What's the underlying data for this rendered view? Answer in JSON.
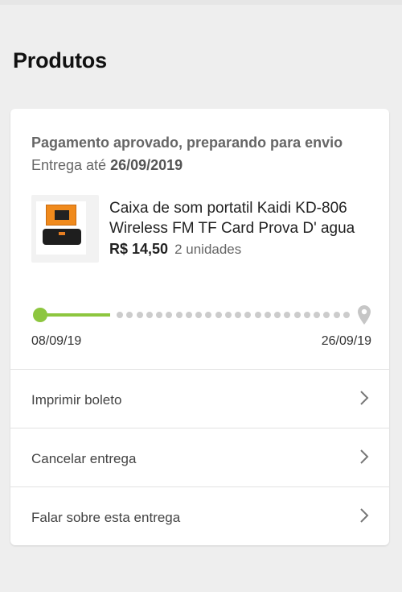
{
  "page": {
    "title": "Produtos"
  },
  "order": {
    "status": "Pagamento aprovado, preparando para envio",
    "delivery_prefix": "Entrega até",
    "delivery_date": "26/09/2019",
    "product": {
      "name": "Caixa de som portatil Kaidi KD-806 Wireless FM TF Card Prova D' agua",
      "price": "R$ 14,50",
      "units": "2 unidades"
    },
    "tracking": {
      "start_date": "08/09/19",
      "end_date": "26/09/19",
      "progress_fraction": 0.22,
      "remaining_dots": 24
    }
  },
  "actions": [
    {
      "label": "Imprimir boleto"
    },
    {
      "label": "Cancelar entrega"
    },
    {
      "label": "Falar sobre esta entrega"
    }
  ],
  "colors": {
    "accent": "#8dc63f",
    "pending": "#cccccc",
    "background": "#eeeeee",
    "card": "#ffffff"
  }
}
